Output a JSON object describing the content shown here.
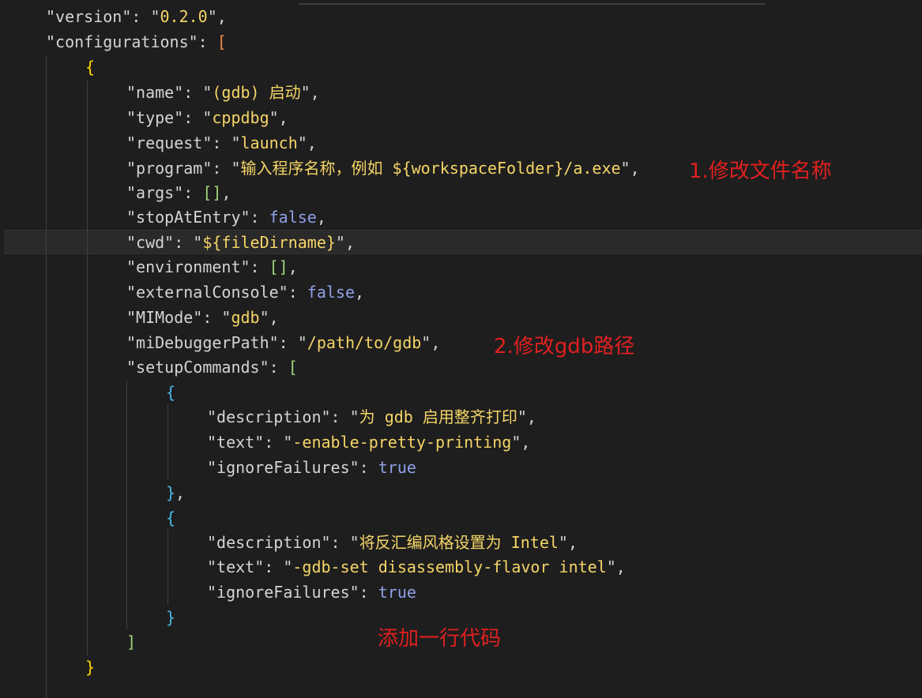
{
  "colors": {
    "background": "#1e1e1e",
    "key": "#d4d4d4",
    "string": "#f5d567",
    "boolean": "#8fa0e8",
    "annotation": "#e02020"
  },
  "code": {
    "l1": {
      "k": "version",
      "v": "0.2.0"
    },
    "l2": {
      "k": "configurations"
    },
    "l4": {
      "k": "name",
      "v": "(gdb) 启动"
    },
    "l5": {
      "k": "type",
      "v": "cppdbg"
    },
    "l6": {
      "k": "request",
      "v": "launch"
    },
    "l7": {
      "k": "program",
      "v": "输入程序名称，例如 ${workspaceFolder}/a.exe"
    },
    "l8": {
      "k": "args"
    },
    "l9": {
      "k": "stopAtEntry",
      "v": "false"
    },
    "l10": {
      "k": "cwd",
      "v": "${fileDirname}"
    },
    "l11": {
      "k": "environment"
    },
    "l12": {
      "k": "externalConsole",
      "v": "false"
    },
    "l13": {
      "k": "MIMode",
      "v": "gdb"
    },
    "l14": {
      "k": "miDebuggerPath",
      "v": "/path/to/gdb"
    },
    "l15": {
      "k": "setupCommands"
    },
    "l17": {
      "k": "description",
      "v": "为 gdb 启用整齐打印"
    },
    "l18": {
      "k": "text",
      "v": "-enable-pretty-printing"
    },
    "l19": {
      "k": "ignoreFailures",
      "v": "true"
    },
    "l22": {
      "k": "description",
      "v": "将反汇编风格设置为 Intel"
    },
    "l23": {
      "k": "text",
      "v": "-gdb-set disassembly-flavor intel"
    },
    "l24": {
      "k": "ignoreFailures",
      "v": "true"
    }
  },
  "annotations": {
    "note1": "1.修改文件名称",
    "note2": "2.修改gdb路径",
    "note3": "添加一行代码"
  }
}
